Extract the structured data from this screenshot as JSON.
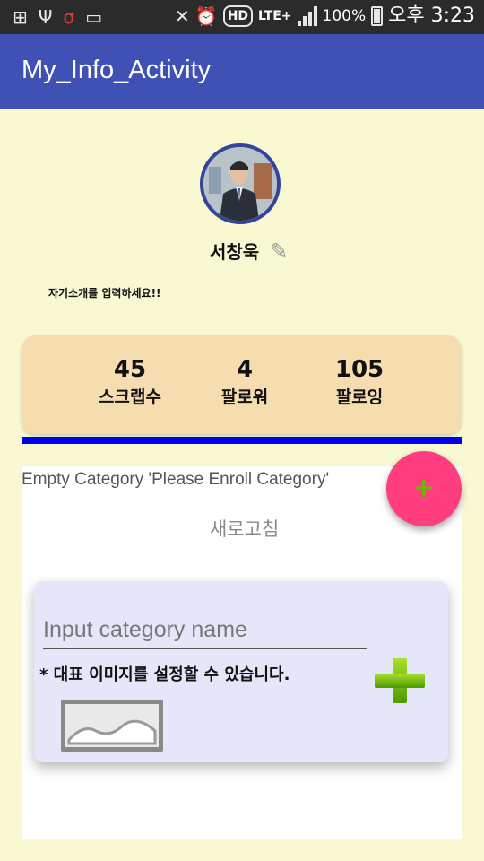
{
  "status_bar": {
    "left_icons": [
      "add-icon",
      "usb-icon",
      "app-icon",
      "cast-icon"
    ],
    "right_icons": [
      "mute-icon",
      "alarm-icon"
    ],
    "hd_label": "HD",
    "network_label": "LTE+",
    "battery_text": "100%",
    "time": "오후 3:23"
  },
  "app_bar": {
    "title": "My_Info_Activity"
  },
  "profile": {
    "name": "서창욱",
    "bio": "자기소개를 입력하세요!!"
  },
  "stats": [
    {
      "value": "45",
      "label": "스크랩수"
    },
    {
      "value": "4",
      "label": "팔로워"
    },
    {
      "value": "105",
      "label": "팔로잉"
    }
  ],
  "content": {
    "empty_message": "Empty Category 'Please Enroll Category'",
    "refresh_label": "새로고침"
  },
  "category_form": {
    "placeholder": "Input category name",
    "value": "",
    "note": "* 대표 이미지를 설정할 수 있습니다."
  },
  "fab": {
    "label": "+"
  },
  "colors": {
    "app_bar": "#3f51b5",
    "background": "#f8f8d2",
    "stats_card": "#f5ddb0",
    "divider": "#0000ee",
    "fab": "#ff3d7f",
    "plus_green": "#66bb00",
    "category_card": "#e6e6fb"
  }
}
